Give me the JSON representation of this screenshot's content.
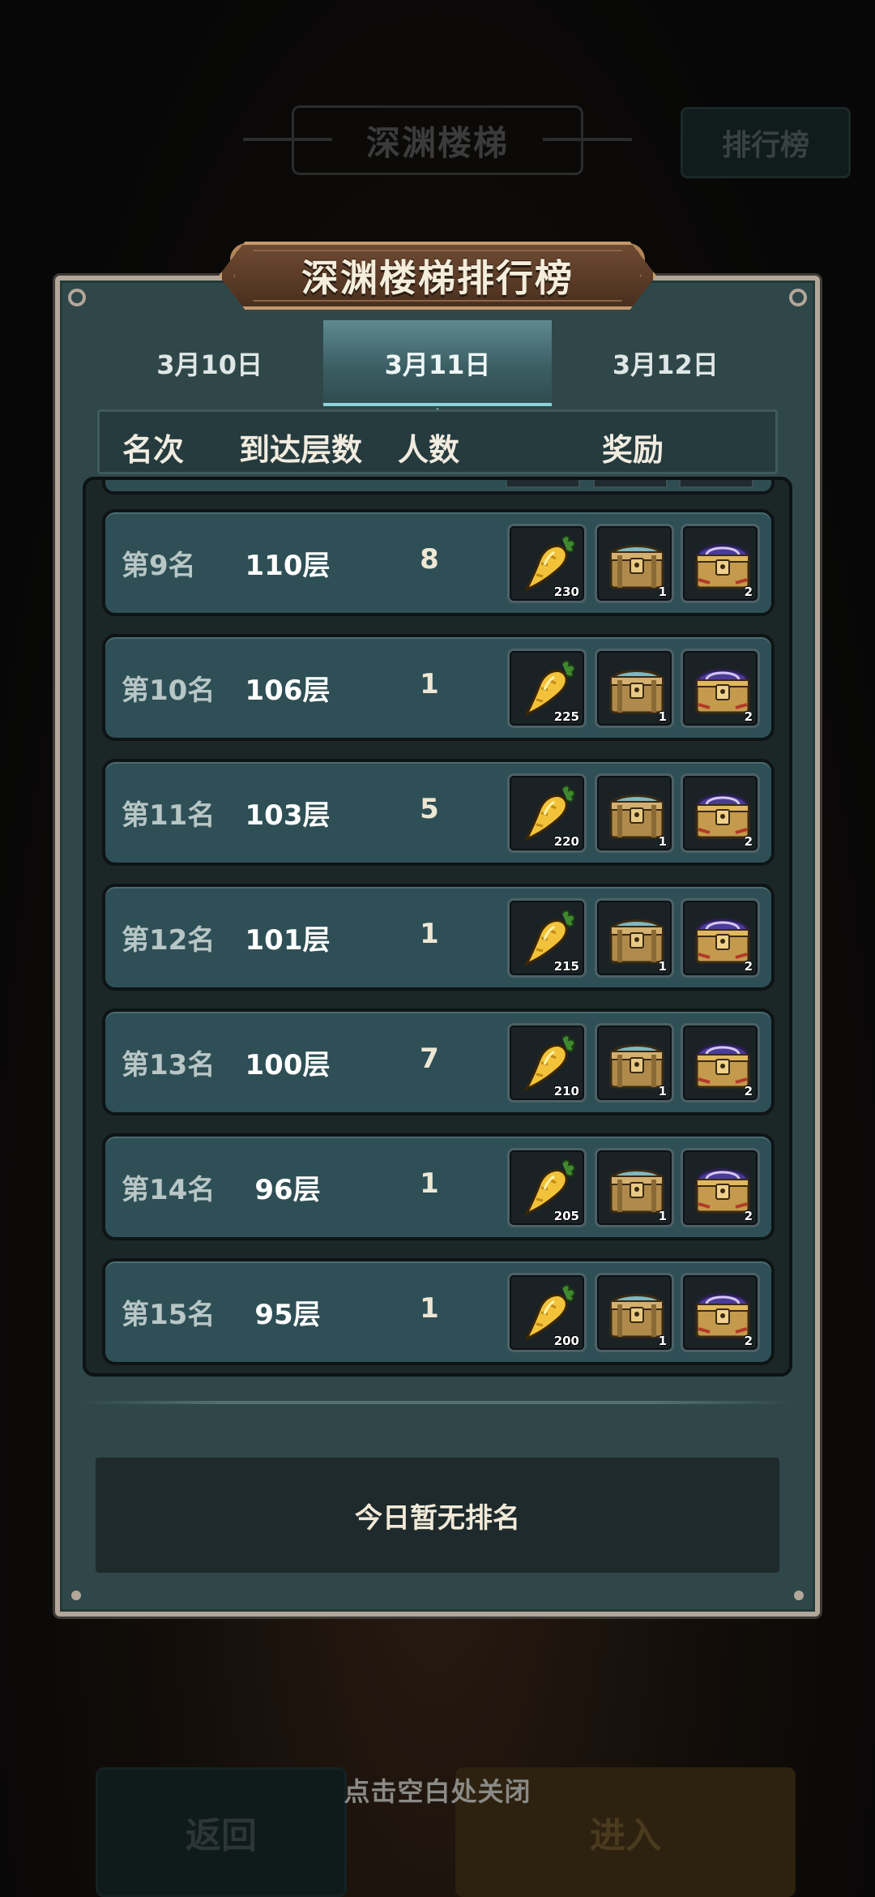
{
  "background": {
    "title": "深渊楼梯",
    "ranking_button": "排行榜",
    "back_button": "返回",
    "enter_button": "进入"
  },
  "panel": {
    "title": "深渊楼梯排行榜",
    "tabs": [
      {
        "label": "3月10日",
        "active": false
      },
      {
        "label": "3月11日",
        "active": true
      },
      {
        "label": "3月12日",
        "active": false
      }
    ],
    "columns": {
      "rank": "名次",
      "floor": "到达层数",
      "count": "人数",
      "reward": "奖励"
    },
    "rows": [
      {
        "rank": "第9名",
        "floor": "110层",
        "count": "8",
        "rewards": [
          "230",
          "1",
          "2"
        ]
      },
      {
        "rank": "第10名",
        "floor": "106层",
        "count": "1",
        "rewards": [
          "225",
          "1",
          "2"
        ]
      },
      {
        "rank": "第11名",
        "floor": "103层",
        "count": "5",
        "rewards": [
          "220",
          "1",
          "2"
        ]
      },
      {
        "rank": "第12名",
        "floor": "101层",
        "count": "1",
        "rewards": [
          "215",
          "1",
          "2"
        ]
      },
      {
        "rank": "第13名",
        "floor": "100层",
        "count": "7",
        "rewards": [
          "210",
          "1",
          "2"
        ]
      },
      {
        "rank": "第14名",
        "floor": "96层",
        "count": "1",
        "rewards": [
          "205",
          "1",
          "2"
        ]
      },
      {
        "rank": "第15名",
        "floor": "95层",
        "count": "1",
        "rewards": [
          "200",
          "1",
          "2"
        ]
      }
    ],
    "reward_icons": [
      "golden-carrot-icon",
      "golden-chest-icon",
      "purple-chest-icon"
    ],
    "today_status": "今日暂无排名"
  },
  "close_hint": "点击空白处关闭",
  "colors": {
    "panel": "#2f4749",
    "row": "#2e4f55",
    "border": "#b3a79a",
    "active_tab": "#8fd3dc"
  }
}
